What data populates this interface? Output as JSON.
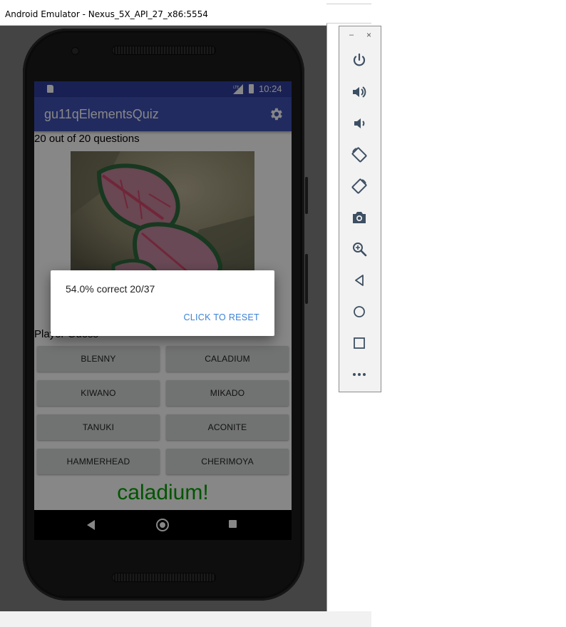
{
  "window": {
    "title": "Android Emulator - Nexus_5X_API_27_x86:5554"
  },
  "status_bar": {
    "time": "10:24"
  },
  "app_bar": {
    "title": "gu11qElementsQuiz",
    "settings_icon": "gear-icon"
  },
  "quiz": {
    "question_count": "20 out of 20 questions",
    "guess_label": "Player Guess",
    "answers": [
      "BLENNY",
      "CALADIUM",
      "KIWANO",
      "MIKADO",
      "TANUKI",
      "ACONITE",
      "HAMMERHEAD",
      "CHERIMOYA"
    ],
    "result": "caladium!",
    "result_color": "#00a000"
  },
  "dialog": {
    "message": "54.0% correct 20/37",
    "reset_label": "CLICK TO RESET"
  },
  "toolbar": {
    "minimize": "–",
    "close": "×",
    "icons": [
      "power-icon",
      "volume-up-icon",
      "volume-down-icon",
      "rotate-left-icon",
      "rotate-right-icon",
      "camera-icon",
      "zoom-icon",
      "back-icon",
      "home-icon",
      "overview-icon",
      "more-icon"
    ]
  },
  "colors": {
    "primary": "#3f51b5",
    "primary_dark": "#303f9f",
    "accent": "#3b82d6"
  }
}
